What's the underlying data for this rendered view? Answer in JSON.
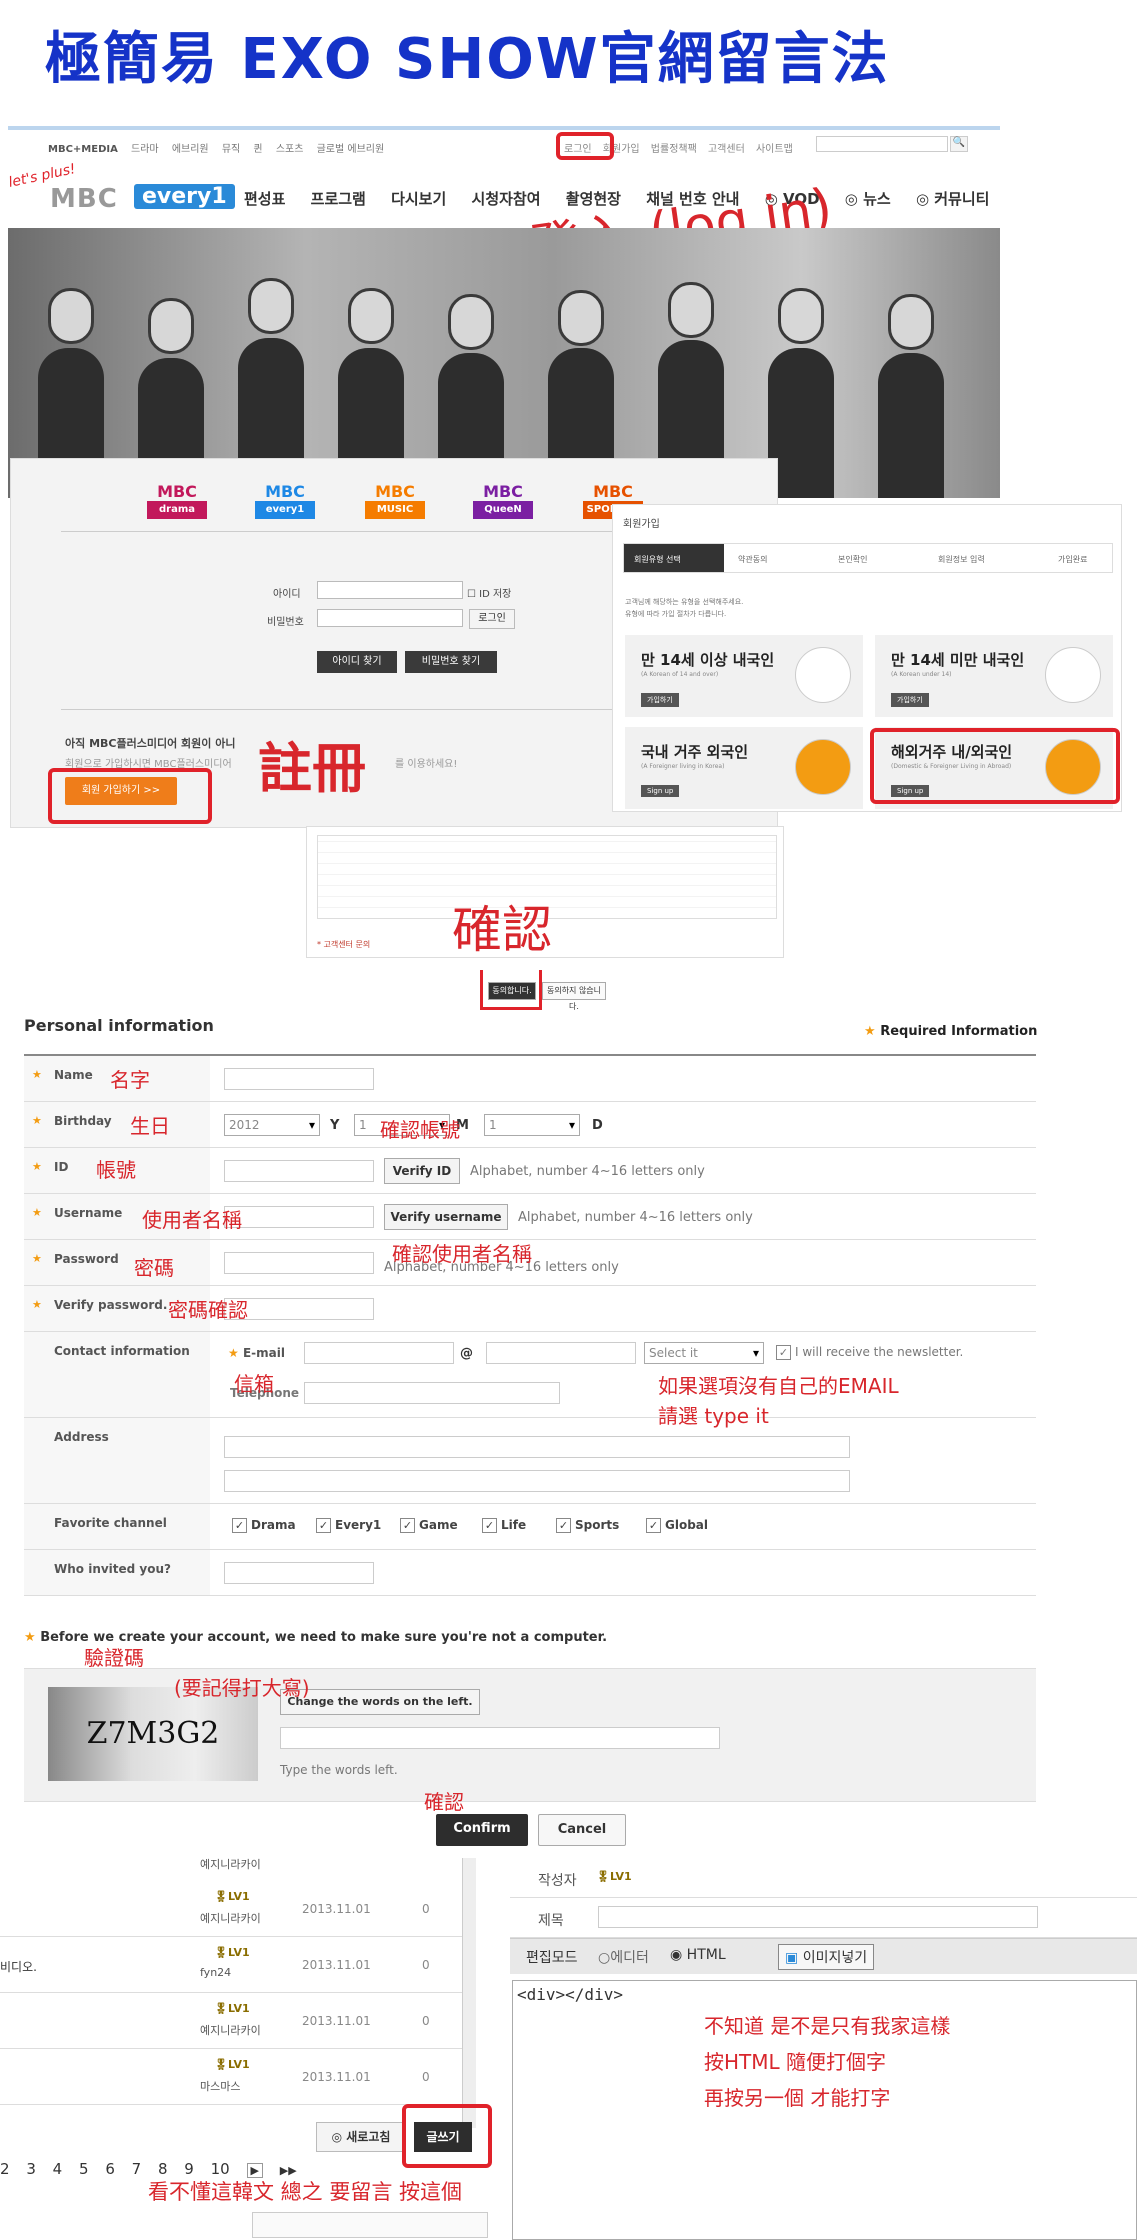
{
  "title": "極簡易 EXO SHOW官網留言法",
  "mbc": {
    "top_nav": [
      "MBC+MEDIA",
      "드라마",
      "에브리원",
      "뮤직",
      "퀸",
      "스포츠",
      "글로벌 에브리원"
    ],
    "util_links": [
      "로그인",
      "회원가입",
      "법률정책팩",
      "고객센터",
      "사이트맵"
    ],
    "search_button": "🔍",
    "lets_plus": "let's plus!",
    "logo_mbc": "MBC",
    "logo_every": "every1",
    "main_nav": [
      "편성표",
      "프로그램",
      "다시보기",
      "시청자참여",
      "촬영현장",
      "채널 번호 안내",
      "◎ VOD",
      "◎ 뉴스",
      "◎ 커뮤니티"
    ]
  },
  "annotations": {
    "login_note": "登入 (log in)",
    "register_note": "註冊",
    "confirm_note": "確認",
    "name_note": "名字",
    "birthday_note": "生日",
    "id_note": "帳號",
    "verify_id_note": "確認帳號",
    "username_note": "使用者名稱",
    "verify_username_note": "確認使用者名稱",
    "password_note": "密碼",
    "verify_password_note": "密碼確認",
    "email_note": "信箱",
    "email_hint_line1": "如果選項沒有自己的EMAIL",
    "email_hint_line2": "請選 type it",
    "captcha_note": "驗證碼",
    "captcha_case_note": "(要記得打大寫)",
    "confirm_note2": "確認",
    "editor_note_line1": "不知道 是不是只有我家這樣",
    "editor_note_line2": "按HTML 隨便打個字",
    "editor_note_line3": "再按另一個 才能打字",
    "write_note": "看不懂這韓文 總之 要留言 按這個"
  },
  "login": {
    "channels": [
      {
        "top": "MBC",
        "bottom": "drama",
        "color": "#c2185b"
      },
      {
        "top": "MBC",
        "bottom": "every1",
        "color": "#1e88e5"
      },
      {
        "top": "MBC",
        "bottom": "MUSIC",
        "color": "#f57c00"
      },
      {
        "top": "MBC",
        "bottom": "QueeN",
        "color": "#7b1fa2"
      },
      {
        "top": "MBC",
        "bottom": "SPORTS+",
        "color": "#e65100"
      }
    ],
    "id_label": "아이디",
    "pw_label": "비밀번호",
    "save_id": "ID 저장",
    "login_button": "로그인",
    "find_id": "아이디 찾기",
    "find_pw": "비밀번호 찾기",
    "not_member": "아직 MBC플러스미디어 회원이 아니",
    "not_member_sub": "회원으로 가입하시면 MBC플러스미디어",
    "use_text": "를 이용하세요!",
    "join_button": "회원 가입하기 >>"
  },
  "signup": {
    "title": "회원가입",
    "steps": [
      "회원유형 선택",
      "약관동의",
      "본인확인",
      "회원정보 입력",
      "가입완료"
    ],
    "desc1": "고객님께 해당하는 유형을 선택해주세요.",
    "desc2": "유형에 따라 가입 절차가 다릅니다.",
    "cards": [
      {
        "title": "만 14세 이상 내국인",
        "sub": "(A Korean of 14 and over)",
        "btn": "가입하기"
      },
      {
        "title": "만 14세 미만 내국인",
        "sub": "(A Korean under 14)",
        "btn": "가입하기"
      },
      {
        "title": "국내 거주 외국인",
        "sub": "(A Foreigner living in Korea)",
        "btn": "Sign up"
      },
      {
        "title": "해외거주 내/외국인",
        "sub": "(Domestic & Foreigner Living in Abroad)",
        "btn": "Sign up"
      }
    ]
  },
  "terms": {
    "agree": "동의합니다.",
    "disagree": "동의하지 않습니다.",
    "customer_center": "* 고객센터 문의"
  },
  "form": {
    "heading": "Personal information",
    "required": "Required Information",
    "name_label": "Name",
    "birthday_label": "Birthday",
    "birth_year": "2012",
    "birth_y": "Y",
    "birth_month": "1",
    "birth_m": "M",
    "birth_day": "1",
    "birth_d": "D",
    "id_label": "ID",
    "verify_id": "Verify ID",
    "id_hint": "Alphabet, number 4~16 letters only",
    "username_label": "Username",
    "verify_username": "Verify username",
    "username_hint": "Alphabet, number 4~16 letters only",
    "password_label": "Password",
    "password_hint": "Alphabet, number 4~16 letters only",
    "verify_password_label": "Verify password.",
    "contact_label": "Contact information",
    "email_label": "E-mail",
    "at": "@",
    "select_it": "Select it",
    "newsletter": "I will receive the newsletter.",
    "telephone_label": "Telephone",
    "address_label": "Address",
    "fav_label": "Favorite channel",
    "channels": [
      "Drama",
      "Every1",
      "Game",
      "Life",
      "Sports",
      "Global"
    ],
    "invited_label": "Who invited you?"
  },
  "captcha": {
    "prompt": "Before we create your account, we need to make sure you're not a computer.",
    "code": "Z7M3G2",
    "change_btn": "Change the words on the left.",
    "type_hint": "Type the words left.",
    "confirm": "Confirm",
    "cancel": "Cancel"
  },
  "board": {
    "rows": [
      {
        "title": "",
        "level": "LV1",
        "user": "예지니라카이",
        "date": "2013.11.01",
        "count": "0"
      },
      {
        "title": "비디오.",
        "level": "LV1",
        "user": "fyn24",
        "date": "2013.11.01",
        "count": "0"
      },
      {
        "title": "",
        "level": "LV1",
        "user": "예지니라카이",
        "date": "2013.11.01",
        "count": "0"
      },
      {
        "title": "",
        "level": "LV1",
        "user": "마스마스",
        "date": "2013.11.01",
        "count": "0"
      }
    ],
    "top_user": "예지니라카이",
    "refresh": "새로고침",
    "write": "글쓰기",
    "pages": [
      "2",
      "3",
      "4",
      "5",
      "6",
      "7",
      "8",
      "9",
      "10",
      "▶",
      "▶▶"
    ]
  },
  "editor": {
    "author_label": "작성자",
    "author_level": "LV1",
    "subject_label": "제목",
    "mode_label": "편집모드",
    "mode_editor": "에디터",
    "mode_html": "HTML",
    "insert_image": "이미지넣기",
    "content": "<div></div>"
  }
}
